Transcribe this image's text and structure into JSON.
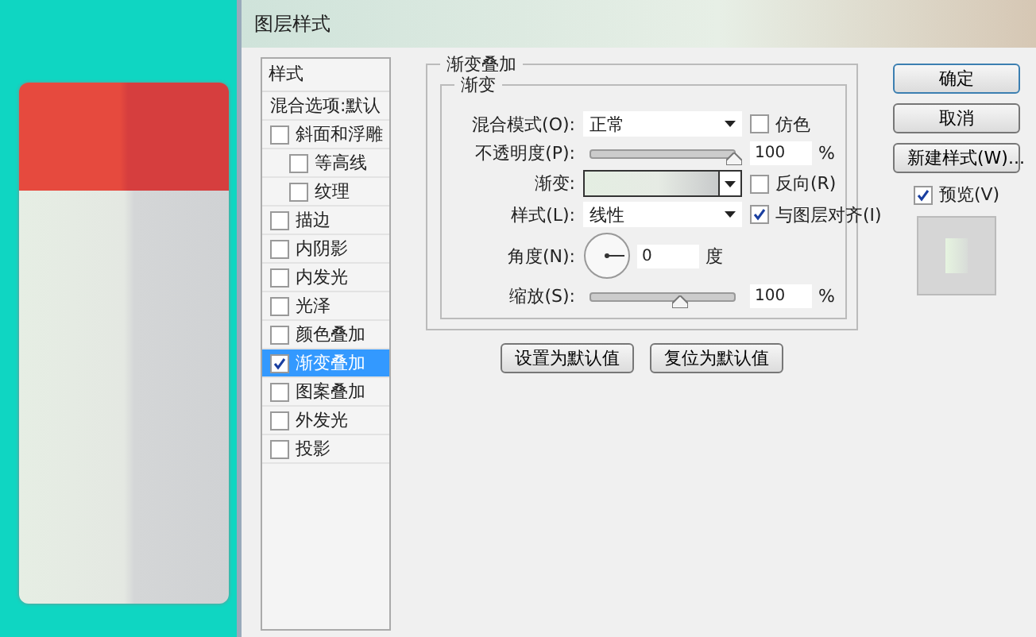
{
  "window": {
    "title": "图层样式"
  },
  "styles_list": {
    "header": "样式",
    "items": [
      {
        "label": "混合选项:默认",
        "kind": "plain",
        "selected": false
      },
      {
        "label": "斜面和浮雕",
        "kind": "check",
        "checked": false,
        "selected": false,
        "children": [
          {
            "label": "等高线",
            "kind": "check",
            "checked": false,
            "selected": false
          },
          {
            "label": "纹理",
            "kind": "check",
            "checked": false,
            "selected": false
          }
        ]
      },
      {
        "label": "描边",
        "kind": "check",
        "checked": false,
        "selected": false
      },
      {
        "label": "内阴影",
        "kind": "check",
        "checked": false,
        "selected": false
      },
      {
        "label": "内发光",
        "kind": "check",
        "checked": false,
        "selected": false
      },
      {
        "label": "光泽",
        "kind": "check",
        "checked": false,
        "selected": false
      },
      {
        "label": "颜色叠加",
        "kind": "check",
        "checked": false,
        "selected": false
      },
      {
        "label": "渐变叠加",
        "kind": "check",
        "checked": true,
        "selected": true
      },
      {
        "label": "图案叠加",
        "kind": "check",
        "checked": false,
        "selected": false
      },
      {
        "label": "外发光",
        "kind": "check",
        "checked": false,
        "selected": false
      },
      {
        "label": "投影",
        "kind": "check",
        "checked": false,
        "selected": false
      }
    ]
  },
  "panel": {
    "title": "渐变叠加",
    "group_title": "渐变",
    "rows": [
      {
        "kind": "select",
        "label": "混合模式(O):",
        "value": "正常",
        "extra": {
          "label": "仿色",
          "checked": false
        }
      },
      {
        "kind": "slider",
        "label": "不透明度(P):",
        "level": 1,
        "value": "100",
        "unit": "%"
      },
      {
        "kind": "gradient",
        "label": "渐变:",
        "extra": {
          "label": "反向(R)",
          "checked": false
        }
      },
      {
        "kind": "select",
        "label": "样式(L):",
        "value": "线性",
        "extra": {
          "label": "与图层对齐(I)",
          "checked": true
        }
      },
      {
        "kind": "angle",
        "label": "角度(N):",
        "value": "0",
        "unit": "度"
      },
      {
        "kind": "slider",
        "label": "缩放(S):",
        "level": 0.62,
        "value": "100",
        "unit": "%"
      }
    ],
    "buttons": [
      "设置为默认值",
      "复位为默认值"
    ]
  },
  "side": {
    "buttons": [
      {
        "label": "确定",
        "default": true
      },
      {
        "label": "取消",
        "default": false
      },
      {
        "label": "新建样式(W)...",
        "default": false
      }
    ],
    "preview": {
      "label": "预览(V)",
      "checked": true
    }
  }
}
